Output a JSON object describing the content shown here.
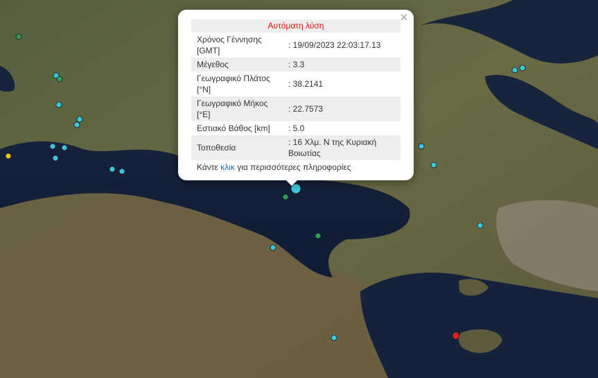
{
  "popup": {
    "title": "Αυτόματη λύση",
    "close": "×",
    "rows": [
      {
        "label": "Χρόνος Γέννησης [GMT]",
        "value": ": 19/09/2023 22:03:17.13"
      },
      {
        "label": "Μέγεθος",
        "value": ": 3.3"
      },
      {
        "label": "Γεωγραφικό Πλάτος [°N]",
        "value": ": 38.2141"
      },
      {
        "label": "Γεωγραφικό Μήκος [°E]",
        "value": ": 22.7573"
      },
      {
        "label": "Εστιακό Βάθος [km]",
        "value": ": 5.0"
      },
      {
        "label": "Τοποθεσία",
        "value": ": 16 Χλμ. N της Κυριακή Βοιωτίας"
      }
    ],
    "more_prefix": "Κάντε ",
    "more_link": "κλικ",
    "more_suffix": " για περισσότερες πληροφορίες"
  },
  "colors": {
    "marker_cyan": "#3cc6dc",
    "marker_green": "#2e9e5a",
    "marker_yellow": "#e8c21e",
    "marker_red": "#e02020",
    "title_red": "#e01010",
    "link_blue": "#1a6fb0"
  }
}
